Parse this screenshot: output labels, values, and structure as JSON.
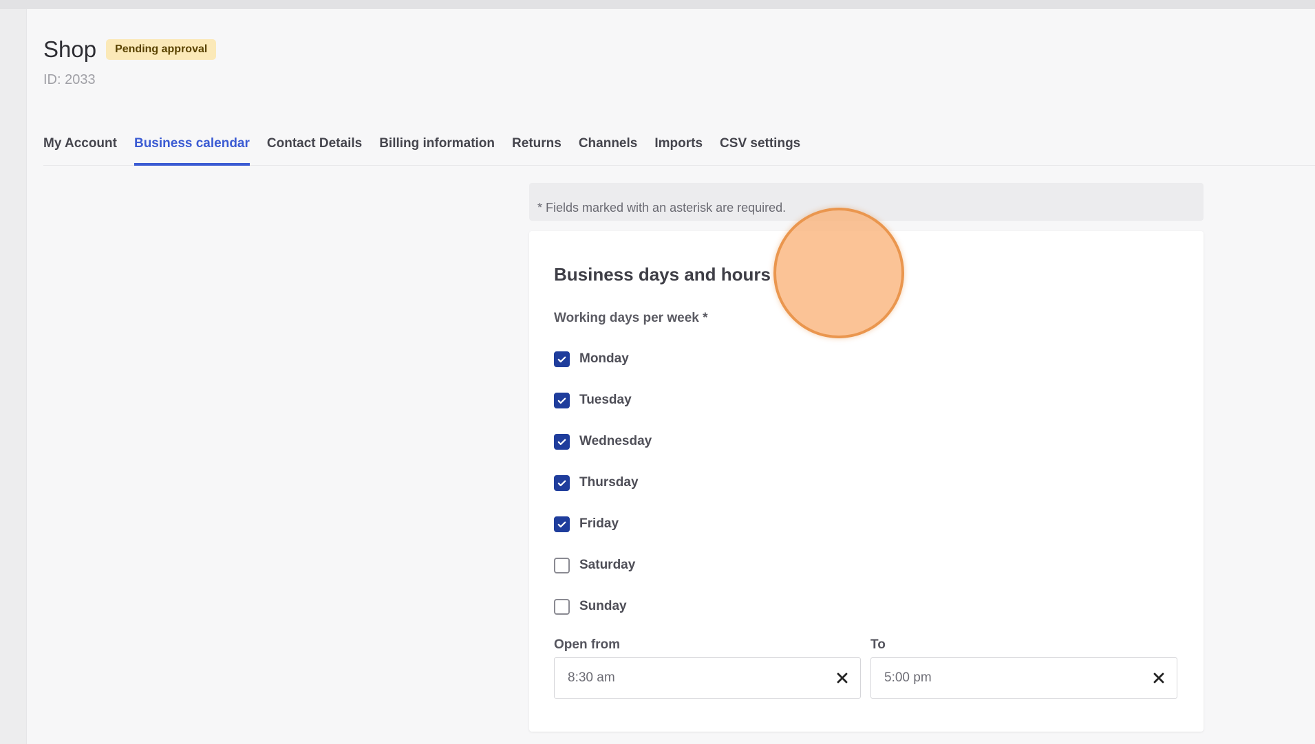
{
  "header": {
    "title": "Shop",
    "badge": "Pending approval",
    "id_text": "ID: 2033"
  },
  "tabs": [
    {
      "label": "My Account",
      "active": false
    },
    {
      "label": "Business calendar",
      "active": true
    },
    {
      "label": "Contact Details",
      "active": false
    },
    {
      "label": "Billing information",
      "active": false
    },
    {
      "label": "Returns",
      "active": false
    },
    {
      "label": "Channels",
      "active": false
    },
    {
      "label": "Imports",
      "active": false
    },
    {
      "label": "CSV settings",
      "active": false
    }
  ],
  "form": {
    "required_note": "* Fields marked with an asterisk are required.",
    "section_title": "Business days and hours",
    "days_label": "Working days per week *",
    "days": [
      {
        "label": "Monday",
        "checked": true
      },
      {
        "label": "Tuesday",
        "checked": true
      },
      {
        "label": "Wednesday",
        "checked": true
      },
      {
        "label": "Thursday",
        "checked": true
      },
      {
        "label": "Friday",
        "checked": true
      },
      {
        "label": "Saturday",
        "checked": false
      },
      {
        "label": "Sunday",
        "checked": false
      }
    ],
    "open_from_label": "Open from",
    "open_from_value": "8:30 am",
    "to_label": "To",
    "to_value": "5:00 pm"
  },
  "colors": {
    "accent": "#3b5bd3",
    "checkbox_checked": "#1f3d9c",
    "badge_bg": "#fbe9b8",
    "cursor_highlight": "#fab278"
  },
  "icons": {
    "checkbox_check": "check-icon",
    "clear": "close-icon"
  }
}
